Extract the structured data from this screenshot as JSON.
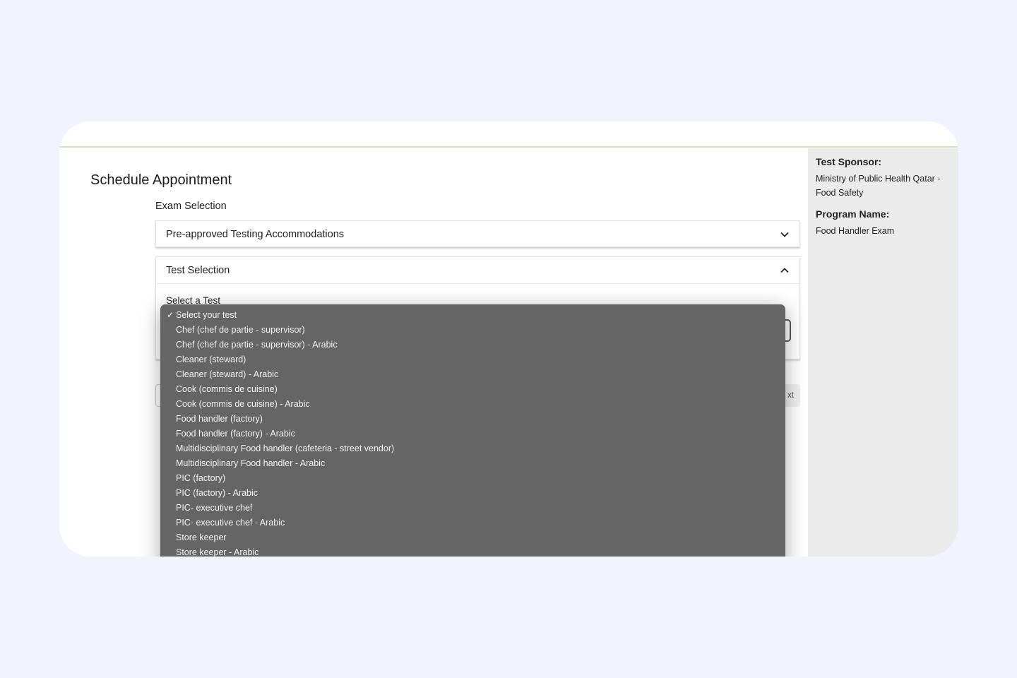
{
  "page": {
    "title": "Schedule Appointment",
    "exam_selection_label": "Exam Selection"
  },
  "accordions": {
    "accommodations": {
      "label": "Pre-approved Testing Accommodations",
      "expanded": false
    },
    "test_selection": {
      "label": "Test Selection",
      "expanded": true
    }
  },
  "test_select": {
    "label": "Select a Test",
    "selected": "Select your test",
    "options": [
      "Select your test",
      "Chef (chef de partie - supervisor)",
      "Chef (chef de partie - supervisor) - Arabic",
      "Cleaner (steward)",
      "Cleaner (steward) - Arabic",
      "Cook (commis de cuisine)",
      "Cook (commis de cuisine) - Arabic",
      "Food handler (factory)",
      "Food handler (factory) - Arabic",
      "Multidisciplinary Food handler (cafeteria - street vendor)",
      "Multidisciplinary Food handler - Arabic",
      "PIC (factory)",
      "PIC (factory) - Arabic",
      "PIC- executive chef",
      "PIC- executive chef - Arabic",
      "Store keeper",
      "Store keeper - Arabic"
    ]
  },
  "buttons": {
    "next_partial": "xt"
  },
  "sidebar": {
    "sponsor_heading": "Test Sponsor:",
    "sponsor_value": "Ministry of Public Health Qatar - Food Safety",
    "program_heading": "Program Name:",
    "program_value": "Food Handler Exam"
  },
  "colors": {
    "page_bg": "#eff4fe",
    "dropdown_bg": "#656565",
    "sidebar_bg": "#ebebeb",
    "accent_line": "#cfe3bf"
  }
}
